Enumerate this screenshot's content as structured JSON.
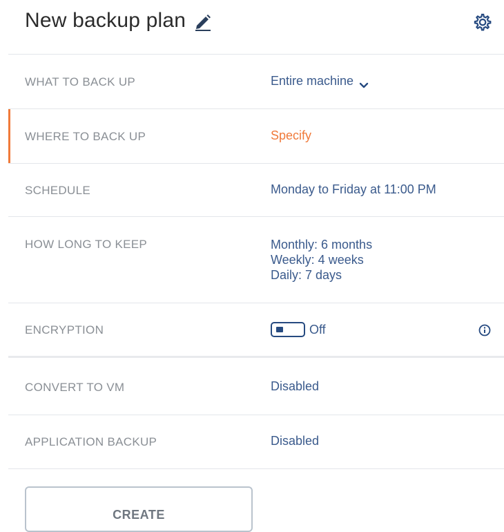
{
  "header": {
    "title": "New backup plan",
    "edit_icon": "pencil-icon",
    "settings_icon": "gear-icon"
  },
  "colors": {
    "accent": "#f07a3a",
    "value_text": "#3a5a8c",
    "label_text": "#8a8f95",
    "title_text": "#2b2b2b",
    "divider": "#e3e6ea"
  },
  "rows": {
    "what_to_back_up": {
      "label": "WHAT TO BACK UP",
      "value": "Entire machine",
      "icon": "chevron-down-icon"
    },
    "where_to_back_up": {
      "label": "WHERE TO BACK UP",
      "value": "Specify"
    },
    "schedule": {
      "label": "SCHEDULE",
      "value": "Monday to Friday at 11:00 PM"
    },
    "how_long_to_keep": {
      "label": "HOW LONG TO KEEP",
      "values": [
        "Monthly: 6 months",
        "Weekly: 4 weeks",
        "Daily: 7 days"
      ]
    },
    "encryption": {
      "label": "ENCRYPTION",
      "toggle_state": "Off",
      "icon": "info-icon"
    },
    "convert_to_vm": {
      "label": "CONVERT TO VM",
      "value": "Disabled"
    },
    "application_backup": {
      "label": "APPLICATION BACKUP",
      "value": "Disabled"
    }
  },
  "actions": {
    "create_label": "CREATE"
  }
}
